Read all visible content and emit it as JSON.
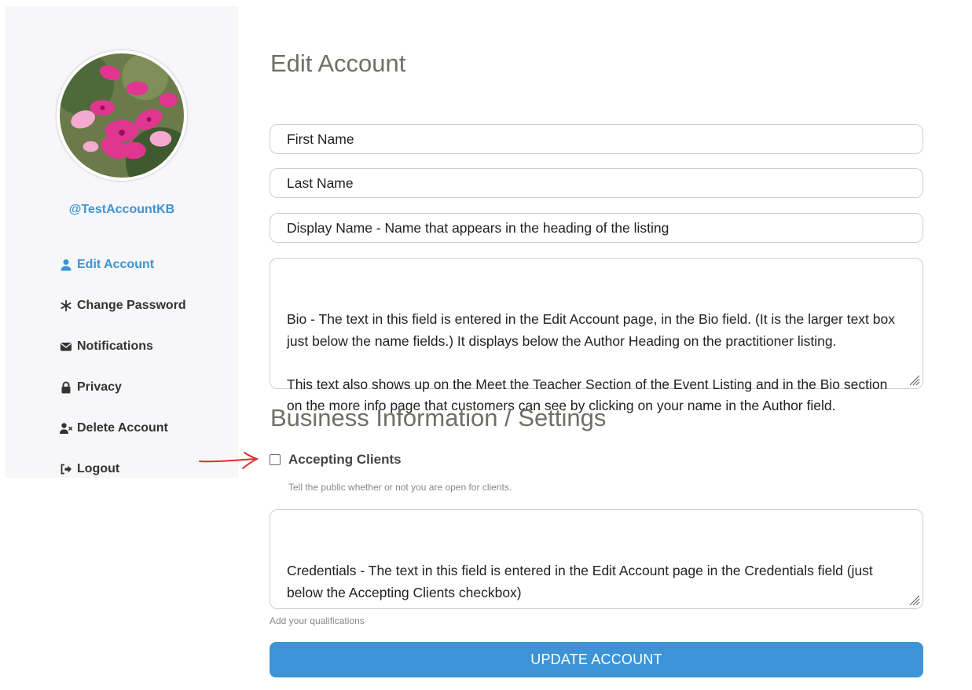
{
  "sidebar": {
    "username": "@TestAccountKB",
    "items": [
      {
        "label": "Edit Account",
        "icon": "user-icon",
        "active": true
      },
      {
        "label": "Change Password",
        "icon": "asterisk-icon",
        "active": false
      },
      {
        "label": "Notifications",
        "icon": "envelope-icon",
        "active": false
      },
      {
        "label": "Privacy",
        "icon": "lock-icon",
        "active": false
      },
      {
        "label": "Delete Account",
        "icon": "user-times-icon",
        "active": false
      },
      {
        "label": "Logout",
        "icon": "sign-out-icon",
        "active": false
      }
    ]
  },
  "main": {
    "title": "Edit Account",
    "first_name": "First Name",
    "last_name": "Last Name",
    "display_name": "Display Name - Name that appears in the heading of the listing",
    "bio": "Bio - The text in this field is entered in the Edit Account page, in the Bio field. (It is the larger text box just below the name fields.) It displays below the Author Heading on the practitioner listing.\n\nThis text also shows up on the Meet the Teacher Section of the Event Listing and in the Bio section on the more info page that customers can see by clicking on your name in the Author field.",
    "business_heading": "Business Information / Settings",
    "accepting_clients_label": "Accepting Clients",
    "accepting_clients_checked": false,
    "accepting_clients_help": "Tell the public whether or not you are open for clients.",
    "credentials": "Credentials - The text in this field is entered in the Edit Account page in the Credentials field (just below the Accepting Clients checkbox)",
    "credentials_help": "Add your qualifications",
    "update_button": "UPDATE ACCOUNT"
  },
  "colors": {
    "accent": "#3d93d1",
    "button": "#3d93d6",
    "heading": "#6f6f66",
    "sidebar_bg": "#f7f7f9",
    "annotation_arrow": "#d9302b"
  }
}
